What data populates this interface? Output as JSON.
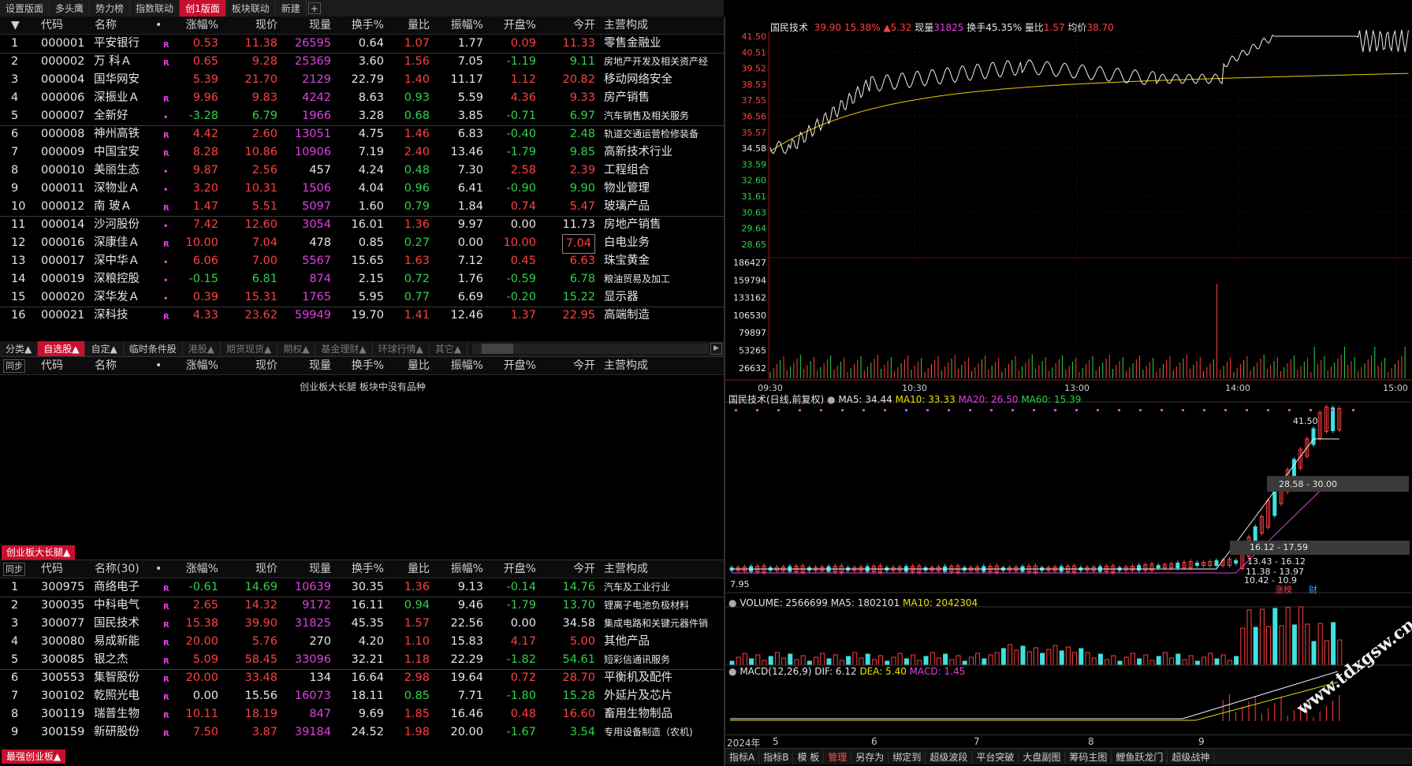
{
  "top_tabs": [
    "设置版面",
    "多头鹰",
    "势力榜",
    "指数联动",
    "创1版面",
    "板块联动",
    "新建"
  ],
  "headers": [
    "代码",
    "名称",
    "•",
    "涨幅%",
    "现价",
    "现量",
    "换手%",
    "量比",
    "振幅%",
    "开盘%",
    "今开",
    "主营构成"
  ],
  "stocks_top": [
    {
      "n": "1",
      "code": "000001",
      "name": "平安银行",
      "mk": "R",
      "chg": "0.53",
      "price": "11.38",
      "vol": "26595",
      "turn": "0.64",
      "qr": "1.07",
      "amp": "1.77",
      "openp": "0.09",
      "open": "11.33",
      "biz": "零售金融业",
      "c": [
        "red",
        "red",
        "mag",
        "white",
        "red",
        "white",
        "red",
        "red"
      ]
    },
    {
      "n": "2",
      "code": "000002",
      "name": "万 科Ａ",
      "mk": "R",
      "chg": "0.65",
      "price": "9.28",
      "vol": "25369",
      "turn": "3.60",
      "qr": "1.56",
      "amp": "7.05",
      "openp": "-1.19",
      "open": "9.11",
      "biz": "房地产开发及相关资产经",
      "c": [
        "red",
        "red",
        "mag",
        "white",
        "red",
        "white",
        "green",
        "green"
      ]
    },
    {
      "n": "3",
      "code": "000004",
      "name": "国华网安",
      "mk": "",
      "chg": "5.39",
      "price": "21.70",
      "vol": "2129",
      "turn": "22.79",
      "qr": "1.40",
      "amp": "11.17",
      "openp": "1.12",
      "open": "20.82",
      "biz": "移动网络安全",
      "c": [
        "red",
        "red",
        "mag",
        "white",
        "red",
        "white",
        "red",
        "red"
      ]
    },
    {
      "n": "4",
      "code": "000006",
      "name": "深振业Ａ",
      "mk": "R",
      "chg": "9.96",
      "price": "9.83",
      "vol": "4242",
      "turn": "8.63",
      "qr": "0.93",
      "amp": "5.59",
      "openp": "4.36",
      "open": "9.33",
      "biz": "房产销售",
      "c": [
        "red",
        "red",
        "mag",
        "white",
        "green",
        "white",
        "red",
        "red"
      ]
    },
    {
      "n": "5",
      "code": "000007",
      "name": "全新好",
      "mk": "•",
      "chg": "-3.28",
      "price": "6.79",
      "vol": "1966",
      "turn": "3.28",
      "qr": "0.68",
      "amp": "3.85",
      "openp": "-0.71",
      "open": "6.97",
      "biz": "汽车销售及相关服务",
      "c": [
        "green",
        "green",
        "mag",
        "white",
        "green",
        "white",
        "green",
        "green"
      ]
    },
    {
      "n": "6",
      "code": "000008",
      "name": "神州高铁",
      "mk": "R",
      "chg": "4.42",
      "price": "2.60",
      "vol": "13051",
      "turn": "4.75",
      "qr": "1.46",
      "amp": "6.83",
      "openp": "-0.40",
      "open": "2.48",
      "biz": "轨道交通运营检修装备",
      "c": [
        "red",
        "red",
        "mag",
        "white",
        "red",
        "white",
        "green",
        "green"
      ]
    },
    {
      "n": "7",
      "code": "000009",
      "name": "中国宝安",
      "mk": "R",
      "chg": "8.28",
      "price": "10.86",
      "vol": "10906",
      "turn": "7.19",
      "qr": "2.40",
      "amp": "13.46",
      "openp": "-1.79",
      "open": "9.85",
      "biz": "高新技术行业",
      "c": [
        "red",
        "red",
        "mag",
        "white",
        "red",
        "white",
        "green",
        "green"
      ]
    },
    {
      "n": "8",
      "code": "000010",
      "name": "美丽生态",
      "mk": "•",
      "chg": "9.87",
      "price": "2.56",
      "vol": "457",
      "turn": "4.24",
      "qr": "0.48",
      "amp": "7.30",
      "openp": "2.58",
      "open": "2.39",
      "biz": "工程组合",
      "c": [
        "red",
        "red",
        "white",
        "white",
        "green",
        "white",
        "red",
        "red"
      ]
    },
    {
      "n": "9",
      "code": "000011",
      "name": "深物业Ａ",
      "mk": "•",
      "chg": "3.20",
      "price": "10.31",
      "vol": "1506",
      "turn": "4.04",
      "qr": "0.96",
      "amp": "6.41",
      "openp": "-0.90",
      "open": "9.90",
      "biz": "物业管理",
      "c": [
        "red",
        "red",
        "mag",
        "white",
        "green",
        "white",
        "green",
        "green"
      ]
    },
    {
      "n": "10",
      "code": "000012",
      "name": "南 玻Ａ",
      "mk": "R",
      "chg": "1.47",
      "price": "5.51",
      "vol": "5097",
      "turn": "1.60",
      "qr": "0.79",
      "amp": "1.84",
      "openp": "0.74",
      "open": "5.47",
      "biz": "玻璃产品",
      "c": [
        "red",
        "red",
        "mag",
        "white",
        "green",
        "white",
        "red",
        "red"
      ]
    },
    {
      "n": "11",
      "code": "000014",
      "name": "沙河股份",
      "mk": "•",
      "chg": "7.42",
      "price": "12.60",
      "vol": "3054",
      "turn": "16.01",
      "qr": "1.36",
      "amp": "9.97",
      "openp": "0.00",
      "open": "11.73",
      "biz": "房地产销售",
      "c": [
        "red",
        "red",
        "mag",
        "white",
        "red",
        "white",
        "white",
        "white"
      ]
    },
    {
      "n": "12",
      "code": "000016",
      "name": "深康佳Ａ",
      "mk": "R",
      "chg": "10.00",
      "price": "7.04",
      "vol": "478",
      "turn": "0.85",
      "qr": "0.27",
      "amp": "0.00",
      "openp": "10.00",
      "open": "7.04",
      "biz": "白电业务",
      "c": [
        "red",
        "red",
        "white",
        "white",
        "green",
        "white",
        "red",
        "red"
      ]
    },
    {
      "n": "13",
      "code": "000017",
      "name": "深中华Ａ",
      "mk": "•",
      "chg": "6.06",
      "price": "7.00",
      "vol": "5567",
      "turn": "15.65",
      "qr": "1.63",
      "amp": "7.12",
      "openp": "0.45",
      "open": "6.63",
      "biz": "珠宝黄金",
      "c": [
        "red",
        "red",
        "mag",
        "white",
        "red",
        "white",
        "red",
        "red"
      ]
    },
    {
      "n": "14",
      "code": "000019",
      "name": "深粮控股",
      "mk": "•",
      "chg": "-0.15",
      "price": "6.81",
      "vol": "874",
      "turn": "2.15",
      "qr": "0.72",
      "amp": "1.76",
      "openp": "-0.59",
      "open": "6.78",
      "biz": "粮油贸易及加工",
      "c": [
        "green",
        "green",
        "mag",
        "white",
        "green",
        "white",
        "green",
        "green"
      ]
    },
    {
      "n": "15",
      "code": "000020",
      "name": "深华发Ａ",
      "mk": "•",
      "chg": "0.39",
      "price": "15.31",
      "vol": "1765",
      "turn": "5.95",
      "qr": "0.77",
      "amp": "6.69",
      "openp": "-0.20",
      "open": "15.22",
      "biz": "显示器",
      "c": [
        "red",
        "red",
        "mag",
        "white",
        "green",
        "white",
        "green",
        "green"
      ]
    },
    {
      "n": "16",
      "code": "000021",
      "name": "深科技",
      "mk": "R",
      "chg": "4.33",
      "price": "23.62",
      "vol": "59949",
      "turn": "19.70",
      "qr": "1.41",
      "amp": "12.46",
      "openp": "1.37",
      "open": "22.95",
      "biz": "高端制造",
      "c": [
        "red",
        "red",
        "mag",
        "white",
        "red",
        "white",
        "red",
        "red"
      ]
    }
  ],
  "mid_tabs": [
    "分类▲",
    "自选股▲",
    "自定▲",
    "临时条件股",
    "港股▲",
    "期货现货▲",
    "期权▲",
    "基金理财▲",
    "环球行情▲",
    "其它▲"
  ],
  "mid_sync": "同步",
  "mid_empty": "创业板大长腿 板块中没有品种",
  "bottom_section": "创业板大长腿▲",
  "bottom_sync": "同步",
  "bottom_name_hdr": "名称(30)",
  "stocks_bottom": [
    {
      "n": "1",
      "code": "300975",
      "name": "商络电子",
      "mk": "R",
      "chg": "-0.61",
      "price": "14.69",
      "vol": "10639",
      "turn": "30.35",
      "qr": "1.36",
      "amp": "9.13",
      "openp": "-0.14",
      "open": "14.76",
      "biz": "汽车及工业行业",
      "c": [
        "green",
        "green",
        "mag",
        "white",
        "red",
        "white",
        "green",
        "green"
      ]
    },
    {
      "n": "2",
      "code": "300035",
      "name": "中科电气",
      "mk": "R",
      "chg": "2.65",
      "price": "14.32",
      "vol": "9172",
      "turn": "16.11",
      "qr": "0.94",
      "amp": "9.46",
      "openp": "-1.79",
      "open": "13.70",
      "biz": "锂离子电池负极材料",
      "c": [
        "red",
        "red",
        "mag",
        "white",
        "green",
        "white",
        "green",
        "green"
      ]
    },
    {
      "n": "3",
      "code": "300077",
      "name": "国民技术",
      "mk": "R",
      "chg": "15.38",
      "price": "39.90",
      "vol": "31825",
      "turn": "45.35",
      "qr": "1.57",
      "amp": "22.56",
      "openp": "0.00",
      "open": "34.58",
      "biz": "集成电路和关键元器件销",
      "c": [
        "red",
        "red",
        "mag",
        "white",
        "red",
        "white",
        "white",
        "white"
      ]
    },
    {
      "n": "4",
      "code": "300080",
      "name": "易成新能",
      "mk": "R",
      "chg": "20.00",
      "price": "5.76",
      "vol": "270",
      "turn": "4.20",
      "qr": "1.10",
      "amp": "15.83",
      "openp": "4.17",
      "open": "5.00",
      "biz": "其他产品",
      "c": [
        "red",
        "red",
        "white",
        "white",
        "red",
        "white",
        "red",
        "red"
      ]
    },
    {
      "n": "5",
      "code": "300085",
      "name": "银之杰",
      "mk": "R",
      "chg": "5.09",
      "price": "58.45",
      "vol": "33096",
      "turn": "32.21",
      "qr": "1.18",
      "amp": "22.29",
      "openp": "-1.82",
      "open": "54.61",
      "biz": "短彩信通讯服务",
      "c": [
        "red",
        "red",
        "mag",
        "white",
        "red",
        "white",
        "green",
        "green"
      ]
    },
    {
      "n": "6",
      "code": "300553",
      "name": "集智股份",
      "mk": "R",
      "chg": "20.00",
      "price": "33.48",
      "vol": "134",
      "turn": "16.64",
      "qr": "2.98",
      "amp": "19.64",
      "openp": "0.72",
      "open": "28.70",
      "biz": "平衡机及配件",
      "c": [
        "red",
        "red",
        "white",
        "white",
        "red",
        "white",
        "red",
        "red"
      ]
    },
    {
      "n": "7",
      "code": "300102",
      "name": "乾照光电",
      "mk": "R",
      "chg": "0.00",
      "price": "15.56",
      "vol": "16073",
      "turn": "18.11",
      "qr": "0.85",
      "amp": "7.71",
      "openp": "-1.80",
      "open": "15.28",
      "biz": "外延片及芯片",
      "c": [
        "white",
        "white",
        "mag",
        "white",
        "green",
        "white",
        "green",
        "green"
      ]
    },
    {
      "n": "8",
      "code": "300119",
      "name": "瑞普生物",
      "mk": "R",
      "chg": "10.11",
      "price": "18.19",
      "vol": "847",
      "turn": "9.69",
      "qr": "1.85",
      "amp": "16.46",
      "openp": "0.48",
      "open": "16.60",
      "biz": "畜用生物制品",
      "c": [
        "red",
        "red",
        "mag",
        "white",
        "red",
        "white",
        "red",
        "red"
      ]
    },
    {
      "n": "9",
      "code": "300159",
      "name": "新研股份",
      "mk": "R",
      "chg": "7.50",
      "price": "3.87",
      "vol": "39184",
      "turn": "24.52",
      "qr": "1.98",
      "amp": "20.00",
      "openp": "-1.67",
      "open": "3.54",
      "biz": "专用设备制造（农机)",
      "c": [
        "red",
        "red",
        "mag",
        "white",
        "red",
        "white",
        "green",
        "green"
      ]
    }
  ],
  "bottom_tag": "最强创业板▲",
  "chart": {
    "intraday_title": {
      "name": "国民技术",
      "price": "39.90",
      "chg": "15.38%",
      "diff": "▲5.32",
      "vol_label": "现量",
      "vol": "31825",
      "turn_label": "换手",
      "turn": "45.35%",
      "qr_label": "量比",
      "qr": "1.57",
      "avg_label": "均价",
      "avg": "38.70"
    },
    "price_ticks": [
      "41.50",
      "40.51",
      "39.52",
      "38.53",
      "37.55",
      "36.56",
      "35.57",
      "34.58",
      "33.59",
      "32.60",
      "31.61",
      "30.63",
      "29.64",
      "28.65"
    ],
    "vol_ticks": [
      "186427",
      "159794",
      "133162",
      "106530",
      "79897",
      "53265",
      "26632"
    ],
    "time_ticks": [
      "09:30",
      "10:30",
      "13:00",
      "14:00",
      "15:00"
    ],
    "daily_title": {
      "name": "国民技术(日线,前复权)",
      "ma5": "MA5: 34.44",
      "ma10": "MA10: 33.33",
      "ma20": "MA20: 26.50",
      "ma60": "MA60: 15.39"
    },
    "daily_labels": {
      "high": "41.50",
      "low": "7.95",
      "r1": "28.58 - 30.00",
      "r2": "16.12 - 17.59",
      "r3": "13.43 - 16.12",
      "r4": "11.38 - 13.97",
      "r5": "10.42 - 10.9",
      "zt": "涨榜",
      "cai": "财"
    },
    "volume_title": {
      "label": "VOLUME: 2566699",
      "ma5": "MA5: 1802101",
      "ma10": "MA10: 2042304"
    },
    "macd_title": {
      "label": "MACD(12,26,9)",
      "dif": "DIF: 6.12",
      "dea": "DEA: 5.40",
      "macd": "MACD: 1.45"
    },
    "date_axis": [
      "2024年",
      "5",
      "6",
      "7",
      "8",
      "9"
    ],
    "bottom_toolbar": [
      "指标A",
      "指标B",
      "模 板",
      "管理",
      "另存为",
      "绑定到",
      "超级波段",
      "平台突破",
      "大盘副图",
      "筹码主图",
      "鲤鱼跃龙门",
      "超级战神"
    ],
    "watermark": "www.tdxgsw.cn"
  }
}
